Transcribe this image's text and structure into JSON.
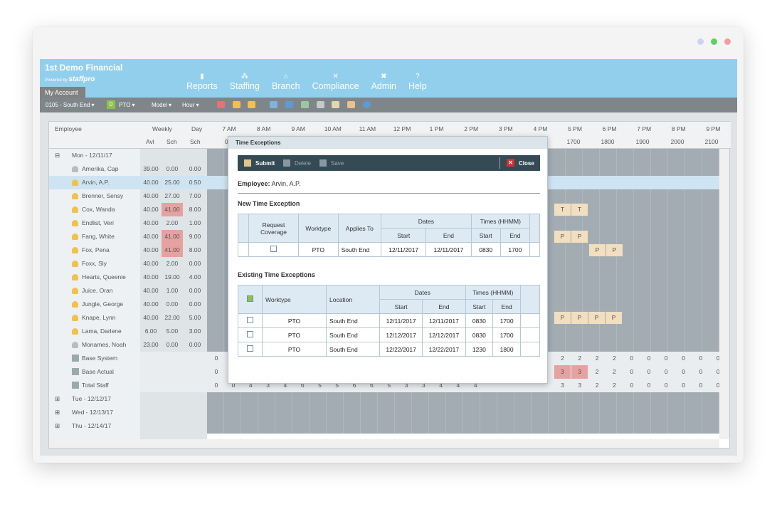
{
  "window": {
    "dots": [
      "#d0d2f2",
      "#5fd15f",
      "#f19e9e"
    ]
  },
  "header": {
    "title": "1st Demo Financial",
    "powered": "Powered by",
    "brand": "staffpro",
    "account": "My Account",
    "nav": [
      {
        "label": "Reports",
        "icon": "bar-chart-icon"
      },
      {
        "label": "Staffing",
        "icon": "org-chart-icon"
      },
      {
        "label": "Branch",
        "icon": "bank-icon"
      },
      {
        "label": "Compliance",
        "icon": "tools-icon"
      },
      {
        "label": "Admin",
        "icon": "wrench-icon"
      },
      {
        "label": "Help",
        "icon": "help-icon"
      }
    ]
  },
  "toolbar": {
    "branch": "0105 - South End",
    "count": "0",
    "type": "PTO",
    "model": "Model",
    "view": "Hour"
  },
  "grid": {
    "head": {
      "employee": "Employee",
      "weekly": "Weekly",
      "day": "Day",
      "avl": "Avl",
      "sch": "Sch",
      "day_sch": "Sch"
    },
    "hours": [
      "7 AM",
      "8 AM",
      "9 AM",
      "10 AM",
      "11 AM",
      "12 PM",
      "1 PM",
      "2 PM",
      "3 PM",
      "4 PM",
      "5 PM",
      "6 PM",
      "7 PM",
      "8 PM",
      "9 PM"
    ],
    "military": [
      "07(",
      "1700",
      "1800",
      "1900",
      "2000",
      "2100"
    ],
    "day_label": "Mon - 12/11/17",
    "rows": [
      {
        "name": "Amerika, Cap",
        "avl": "39.00",
        "sch": "0.00",
        "day": "0.00",
        "gray": true
      },
      {
        "name": "Arvin, A.P.",
        "avl": "40.00",
        "sch": "25.00",
        "day": "0.50",
        "sel": true
      },
      {
        "name": "Brenner, Sensy",
        "avl": "40.00",
        "sch": "27.00",
        "day": "7.00"
      },
      {
        "name": "Cox, Wanda",
        "avl": "40.00",
        "sch": "41.00",
        "day": "8.00",
        "over": true,
        "cells": [
          "T",
          "T"
        ]
      },
      {
        "name": "Endlist, Veri",
        "avl": "40.00",
        "sch": "2.00",
        "day": "1.00"
      },
      {
        "name": "Fang, White",
        "avl": "40.00",
        "sch": "41.00",
        "day": "9.00",
        "over": true,
        "cells": [
          "P",
          "P"
        ]
      },
      {
        "name": "Fox, Pena",
        "avl": "40.00",
        "sch": "41.00",
        "day": "8.00",
        "over": true,
        "cells2": [
          "P",
          "P"
        ]
      },
      {
        "name": "Foxx, Sly",
        "avl": "40.00",
        "sch": "2.00",
        "day": "0.00"
      },
      {
        "name": "Hearts, Queenie",
        "avl": "40.00",
        "sch": "19.00",
        "day": "4.00"
      },
      {
        "name": "Juice, Oran",
        "avl": "40.00",
        "sch": "1.00",
        "day": "0.00"
      },
      {
        "name": "Jungle, George",
        "avl": "40.00",
        "sch": "0.00",
        "day": "0.00"
      },
      {
        "name": "Knape, Lynn",
        "avl": "40.00",
        "sch": "22.00",
        "day": "5.00",
        "cells4": [
          "P",
          "P",
          "P",
          "P"
        ]
      },
      {
        "name": "Lama, Darlene",
        "avl": "6.00",
        "sch": "5.00",
        "day": "3.00"
      },
      {
        "name": "Monames, Noah",
        "avl": "23.00",
        "sch": "0.00",
        "day": "0.00",
        "gray": true
      }
    ],
    "stats": [
      {
        "name": "Base System",
        "left": "0",
        "right": [
          "2",
          "2",
          "2",
          "2",
          "0",
          "0",
          "0",
          "0",
          "0",
          "0"
        ]
      },
      {
        "name": "Base Actual",
        "left": "0",
        "right": [
          "3",
          "3",
          "2",
          "2",
          "0",
          "0",
          "0",
          "0",
          "0",
          "0"
        ],
        "red": true
      },
      {
        "name": "Total Staff",
        "left": "0",
        "mid": [
          "0",
          "4",
          "3",
          "4",
          "6",
          "5",
          "5",
          "6",
          "6",
          "5",
          "3",
          "3",
          "4",
          "4",
          "4"
        ],
        "right": [
          "3",
          "3",
          "2",
          "2",
          "0",
          "0",
          "0",
          "0",
          "0",
          "0"
        ]
      }
    ],
    "days": [
      "Tue - 12/12/17",
      "Wed - 12/13/17",
      "Thu - 12/14/17"
    ]
  },
  "dialog": {
    "title": "Time Exceptions",
    "submit": "Submit",
    "delete": "Delete",
    "save": "Save",
    "close": "Close",
    "employee_label": "Employee:",
    "employee": "Arvin, A.P.",
    "new_title": "New Time Exception",
    "new_head": {
      "req": "Request Coverage",
      "worktype": "Worktype",
      "applies": "Applies To",
      "dates": "Dates",
      "times": "Times (HHMM)",
      "start": "Start",
      "end": "End"
    },
    "new_row": {
      "worktype": "PTO",
      "applies": "South End",
      "ds": "12/11/2017",
      "de": "12/11/2017",
      "ts": "0830",
      "te": "1700"
    },
    "exist_title": "Existing Time Exceptions",
    "exist_head": {
      "worktype": "Worktype",
      "location": "Location",
      "dates": "Dates",
      "times": "Times (HHMM)",
      "start": "Start",
      "end": "End"
    },
    "exist_rows": [
      {
        "worktype": "PTO",
        "location": "South End",
        "ds": "12/11/2017",
        "de": "12/11/2017",
        "ts": "0830",
        "te": "1700"
      },
      {
        "worktype": "PTO",
        "location": "South End",
        "ds": "12/12/2017",
        "de": "12/12/2017",
        "ts": "0830",
        "te": "1700"
      },
      {
        "worktype": "PTO",
        "location": "South End",
        "ds": "12/22/2017",
        "de": "12/22/2017",
        "ts": "1230",
        "te": "1800"
      }
    ]
  }
}
